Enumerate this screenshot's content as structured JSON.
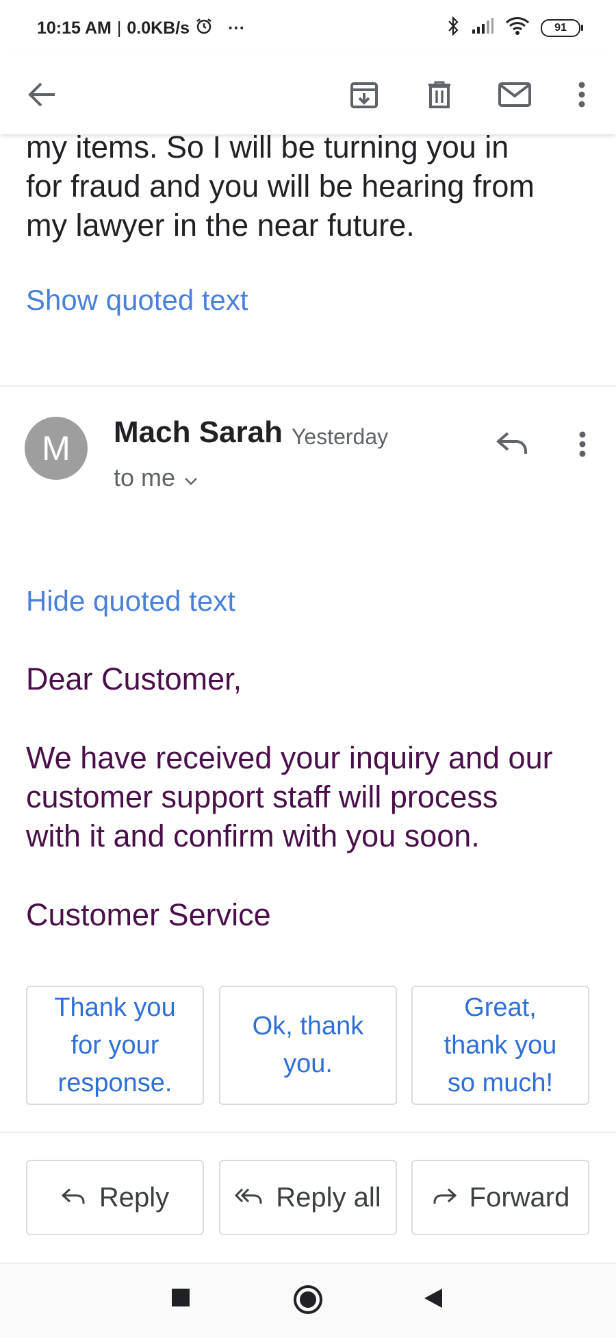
{
  "status_bar": {
    "time": "10:15 AM",
    "separator": "|",
    "net_speed": "0.0KB/s",
    "more": "···",
    "battery": "91"
  },
  "toolbar": {
    "icons": [
      "back-arrow-icon",
      "archive-icon",
      "delete-icon",
      "mark-unread-icon",
      "more-vert-icon"
    ]
  },
  "previous_message": {
    "body_lines": [
      "my items. So I will be turning you in",
      "for fraud and you will be hearing from",
      "my lawyer in the near future."
    ],
    "show_quoted": "Show quoted text"
  },
  "message": {
    "avatar_letter": "M",
    "sender": "Mach Sarah",
    "date": "Yesterday",
    "recipient": "to me",
    "hide_quoted": "Hide quoted text",
    "greeting": "Dear Customer,",
    "body_lines": [
      "We have received your inquiry and our",
      "customer support staff will process",
      "with it and confirm with you soon."
    ],
    "signature": "Customer Service"
  },
  "smart_replies": [
    {
      "lines": [
        "Thank you",
        "for your",
        "response."
      ]
    },
    {
      "lines": [
        "Ok, thank",
        "you."
      ]
    },
    {
      "lines": [
        "Great,",
        "thank you",
        "so much!"
      ]
    }
  ],
  "actions": {
    "reply": "Reply",
    "reply_all": "Reply all",
    "forward": "Forward"
  },
  "colors": {
    "link": "#4a80d9",
    "quoted_text": "#4a0f4a",
    "smart_reply_text": "#2f6fd6"
  }
}
